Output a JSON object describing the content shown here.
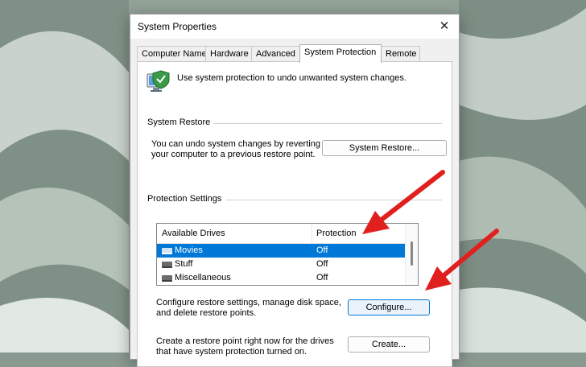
{
  "window": {
    "title": "System Properties",
    "close_glyph": "✕"
  },
  "tabs": [
    {
      "label": "Computer Name",
      "active": false
    },
    {
      "label": "Hardware",
      "active": false
    },
    {
      "label": "Advanced",
      "active": false
    },
    {
      "label": "System Protection",
      "active": true
    },
    {
      "label": "Remote",
      "active": false
    }
  ],
  "intro": {
    "icon": "computer-shield-icon",
    "text": "Use system protection to undo unwanted system changes."
  },
  "system_restore": {
    "group_title": "System Restore",
    "description": "You can undo system changes by reverting your computer to a previous restore point.",
    "button_label": "System Restore..."
  },
  "protection_settings": {
    "group_title": "Protection Settings",
    "columns": [
      "Available Drives",
      "Protection"
    ],
    "drives": [
      {
        "name": "Movies",
        "protection": "Off",
        "selected": true
      },
      {
        "name": "Stuff",
        "protection": "Off",
        "selected": false
      },
      {
        "name": "Miscellaneous",
        "protection": "Off",
        "selected": false
      }
    ],
    "configure_text": "Configure restore settings, manage disk space, and delete restore points.",
    "configure_button": "Configure...",
    "create_text": "Create a restore point right now for the drives that have system protection turned on.",
    "create_button": "Create..."
  },
  "colors": {
    "selection": "#0078d7",
    "annotation_arrow": "#e0201e"
  }
}
